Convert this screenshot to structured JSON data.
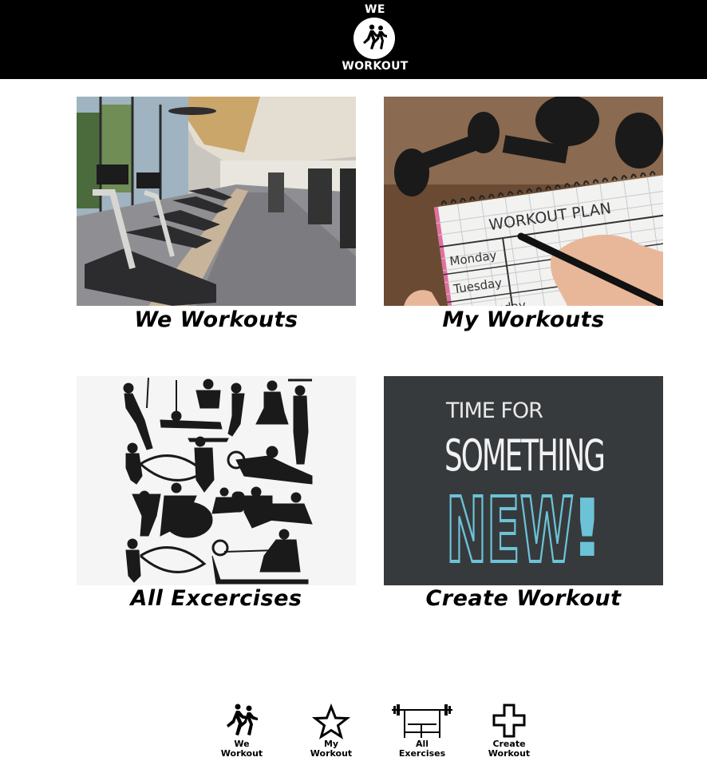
{
  "header": {
    "logo": {
      "top_text": "WE",
      "bottom_text": "WORKOUT",
      "icon": "runners-icon"
    }
  },
  "cards": [
    {
      "label": "We Workouts",
      "image": "gym-treadmills-image"
    },
    {
      "label": "My Workouts",
      "image": "workout-plan-notebook-image",
      "image_text": {
        "heading": "WORKOUT PLAN",
        "day1": "Monday",
        "day2": "Tuesday",
        "day3": "Wednesday"
      }
    },
    {
      "label": "All Excercises",
      "image": "exercise-silhouettes-image"
    },
    {
      "label": "Create Workout",
      "image": "time-for-something-new-chalkboard-image",
      "image_text": {
        "line1": "TIME FOR",
        "line2": "SOMETHING",
        "line3": "NEW",
        "mark": "!"
      }
    }
  ],
  "bottom_nav": [
    {
      "label": "We\nWorkout",
      "icon": "runners-icon"
    },
    {
      "label": "My\nWorkout",
      "icon": "star-icon"
    },
    {
      "label": "All\nExercises",
      "icon": "barbell-bench-icon"
    },
    {
      "label": "Create\nWorkout",
      "icon": "plus-icon"
    }
  ],
  "colors": {
    "header_bg": "#000000",
    "page_bg": "#ffffff",
    "chalk_blue": "#6cc3d8",
    "chalkboard": "#3b3e40"
  }
}
